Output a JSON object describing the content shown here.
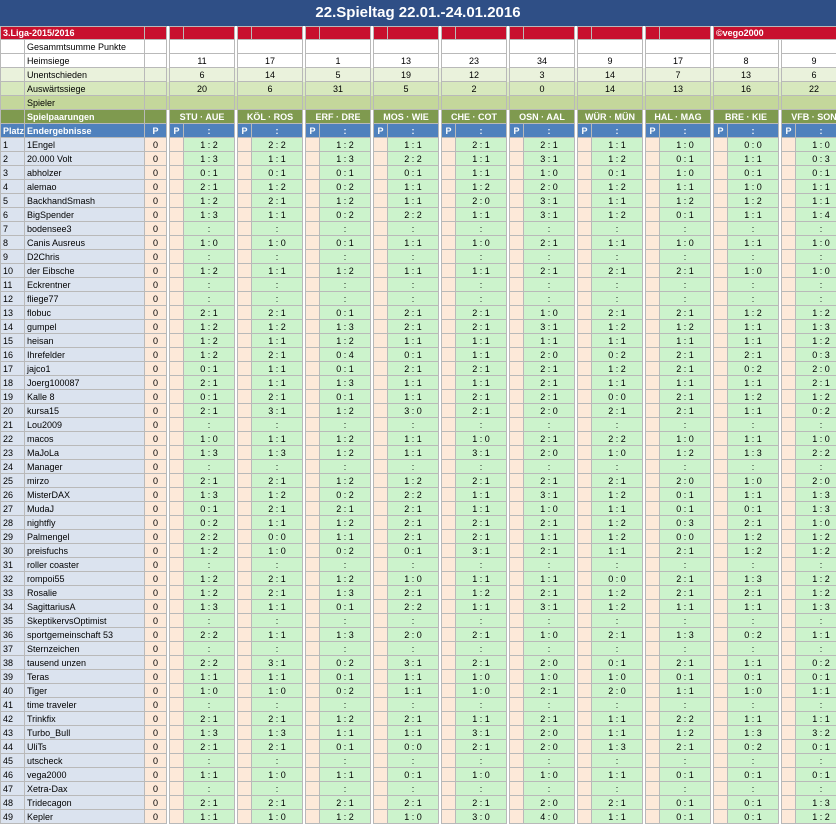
{
  "title": "22.Spieltag 22.01.-24.01.2016",
  "league": "3.Liga-2015/2016",
  "author": "©vego2000",
  "labels": {
    "gesamt": "Gesammtsumme Punkte",
    "heim": "Heimsiege",
    "unent": "Unentschieden",
    "ausw": "Auswärtssiege",
    "spieler": "Spieler",
    "paarungen": "Spielpaarungen",
    "platz": "Platz",
    "endergebnisse": "Endergebnisse",
    "p": "P"
  },
  "matches": [
    "STU · AUE",
    "KÖL · ROS",
    "ERF · DRE",
    "MOS · WIE",
    "CHE · COT",
    "OSN · AAL",
    "WÜR · MÜN",
    "HAL · MAG",
    "BRE · KIE",
    "VFB · SON"
  ],
  "stats": {
    "heimsiege": [
      "11",
      "17",
      "1",
      "13",
      "23",
      "34",
      "9",
      "17",
      "8",
      "9"
    ],
    "unentschieden": [
      "6",
      "14",
      "5",
      "19",
      "12",
      "3",
      "14",
      "7",
      "13",
      "6"
    ],
    "auswaertssiege": [
      "20",
      "6",
      "31",
      "5",
      "2",
      "0",
      "14",
      "13",
      "16",
      "22"
    ]
  },
  "end_results": [
    ":",
    ":",
    ":",
    ":",
    ":",
    ":",
    ":",
    ":",
    ":",
    ":"
  ],
  "players": [
    {
      "rank": "1",
      "name": "1Engel",
      "pts": "0",
      "tips": [
        "1 : 2",
        "2 : 2",
        "1 : 2",
        "1 : 1",
        "2 : 1",
        "2 : 1",
        "1 : 1",
        "1 : 0",
        "0 : 0",
        "1 : 0"
      ]
    },
    {
      "rank": "2",
      "name": "20.000 Volt",
      "pts": "0",
      "tips": [
        "1 : 3",
        "1 : 1",
        "1 : 3",
        "2 : 2",
        "1 : 1",
        "3 : 1",
        "1 : 2",
        "0 : 1",
        "1 : 1",
        "0 : 3"
      ]
    },
    {
      "rank": "3",
      "name": "abholzer",
      "pts": "0",
      "tips": [
        "0 : 1",
        "0 : 1",
        "0 : 1",
        "0 : 1",
        "1 : 1",
        "1 : 0",
        "0 : 1",
        "1 : 0",
        "0 : 1",
        "0 : 1"
      ]
    },
    {
      "rank": "4",
      "name": "alemao",
      "pts": "0",
      "tips": [
        "2 : 1",
        "1 : 2",
        "0 : 2",
        "1 : 1",
        "1 : 2",
        "2 : 0",
        "1 : 2",
        "1 : 1",
        "1 : 0",
        "1 : 1"
      ]
    },
    {
      "rank": "5",
      "name": "BackhandSmash",
      "pts": "0",
      "tips": [
        "1 : 2",
        "2 : 1",
        "1 : 2",
        "1 : 1",
        "2 : 0",
        "3 : 1",
        "1 : 1",
        "1 : 2",
        "1 : 2",
        "1 : 1"
      ]
    },
    {
      "rank": "6",
      "name": "BigSpender",
      "pts": "0",
      "tips": [
        "1 : 3",
        "1 : 1",
        "0 : 2",
        "2 : 2",
        "1 : 1",
        "3 : 1",
        "1 : 2",
        "0 : 1",
        "1 : 1",
        "1 : 4"
      ]
    },
    {
      "rank": "7",
      "name": "bodensee3",
      "pts": "0",
      "tips": [
        ":",
        ":",
        ":",
        ":",
        ":",
        ":",
        ":",
        ":",
        ":",
        ":"
      ]
    },
    {
      "rank": "8",
      "name": "Canis Ausreus",
      "pts": "0",
      "tips": [
        "1 : 0",
        "1 : 0",
        "0 : 1",
        "1 : 1",
        "1 : 0",
        "2 : 1",
        "1 : 1",
        "1 : 0",
        "1 : 1",
        "1 : 0"
      ]
    },
    {
      "rank": "9",
      "name": "D2Chris",
      "pts": "0",
      "tips": [
        ":",
        ":",
        ":",
        ":",
        ":",
        ":",
        ":",
        ":",
        ":",
        ":"
      ]
    },
    {
      "rank": "10",
      "name": "der Eibsche",
      "pts": "0",
      "tips": [
        "1 : 2",
        "1 : 1",
        "1 : 2",
        "1 : 1",
        "1 : 1",
        "2 : 1",
        "2 : 1",
        "2 : 1",
        "1 : 0",
        "1 : 0"
      ]
    },
    {
      "rank": "11",
      "name": "Eckrentner",
      "pts": "0",
      "tips": [
        ":",
        ":",
        ":",
        ":",
        ":",
        ":",
        ":",
        ":",
        ":",
        ":"
      ]
    },
    {
      "rank": "12",
      "name": "fliege77",
      "pts": "0",
      "tips": [
        ":",
        ":",
        ":",
        ":",
        ":",
        ":",
        ":",
        ":",
        ":",
        ":"
      ]
    },
    {
      "rank": "13",
      "name": "flobuc",
      "pts": "0",
      "tips": [
        "2 : 1",
        "2 : 1",
        "0 : 1",
        "2 : 1",
        "2 : 1",
        "1 : 0",
        "2 : 1",
        "2 : 1",
        "1 : 2",
        "1 : 2"
      ]
    },
    {
      "rank": "14",
      "name": "gumpel",
      "pts": "0",
      "tips": [
        "1 : 2",
        "1 : 2",
        "1 : 3",
        "2 : 1",
        "2 : 1",
        "3 : 1",
        "1 : 2",
        "1 : 2",
        "1 : 1",
        "1 : 3"
      ]
    },
    {
      "rank": "15",
      "name": "heisan",
      "pts": "0",
      "tips": [
        "1 : 2",
        "1 : 1",
        "1 : 2",
        "1 : 1",
        "1 : 1",
        "1 : 1",
        "1 : 1",
        "1 : 1",
        "1 : 1",
        "1 : 2"
      ]
    },
    {
      "rank": "16",
      "name": "Ihrefelder",
      "pts": "0",
      "tips": [
        "1 : 2",
        "2 : 1",
        "0 : 4",
        "0 : 1",
        "1 : 1",
        "2 : 0",
        "0 : 2",
        "2 : 1",
        "2 : 1",
        "0 : 3"
      ]
    },
    {
      "rank": "17",
      "name": "jajco1",
      "pts": "0",
      "tips": [
        "0 : 1",
        "1 : 1",
        "0 : 1",
        "2 : 1",
        "2 : 1",
        "2 : 1",
        "1 : 2",
        "2 : 1",
        "0 : 2",
        "2 : 0"
      ]
    },
    {
      "rank": "18",
      "name": "Joerg100087",
      "pts": "0",
      "tips": [
        "2 : 1",
        "1 : 1",
        "1 : 3",
        "1 : 1",
        "1 : 1",
        "2 : 1",
        "1 : 1",
        "1 : 1",
        "1 : 1",
        "2 : 1"
      ]
    },
    {
      "rank": "19",
      "name": "Kalle 8",
      "pts": "0",
      "tips": [
        "0 : 1",
        "2 : 1",
        "0 : 1",
        "1 : 1",
        "2 : 1",
        "2 : 1",
        "0 : 0",
        "2 : 1",
        "1 : 2",
        "1 : 2"
      ]
    },
    {
      "rank": "20",
      "name": "kursa15",
      "pts": "0",
      "tips": [
        "2 : 1",
        "3 : 1",
        "1 : 2",
        "3 : 0",
        "2 : 1",
        "2 : 0",
        "2 : 1",
        "2 : 1",
        "1 : 1",
        "0 : 2"
      ]
    },
    {
      "rank": "21",
      "name": "Lou2009",
      "pts": "0",
      "tips": [
        ":",
        ":",
        ":",
        ":",
        ":",
        ":",
        ":",
        ":",
        ":",
        ":"
      ]
    },
    {
      "rank": "22",
      "name": "macos",
      "pts": "0",
      "tips": [
        "1 : 0",
        "1 : 1",
        "1 : 2",
        "1 : 1",
        "1 : 0",
        "2 : 1",
        "2 : 2",
        "1 : 0",
        "1 : 1",
        "1 : 0"
      ]
    },
    {
      "rank": "23",
      "name": "MaJoLa",
      "pts": "0",
      "tips": [
        "1 : 3",
        "1 : 3",
        "1 : 2",
        "1 : 1",
        "3 : 1",
        "2 : 0",
        "1 : 0",
        "1 : 2",
        "1 : 3",
        "2 : 2"
      ]
    },
    {
      "rank": "24",
      "name": "Manager",
      "pts": "0",
      "tips": [
        ":",
        ":",
        ":",
        ":",
        ":",
        ":",
        ":",
        ":",
        ":",
        ":"
      ]
    },
    {
      "rank": "25",
      "name": "mirzo",
      "pts": "0",
      "tips": [
        "2 : 1",
        "2 : 1",
        "1 : 2",
        "1 : 2",
        "2 : 1",
        "2 : 1",
        "2 : 1",
        "2 : 0",
        "1 : 0",
        "2 : 0"
      ]
    },
    {
      "rank": "26",
      "name": "MisterDAX",
      "pts": "0",
      "tips": [
        "1 : 3",
        "1 : 2",
        "0 : 2",
        "2 : 2",
        "1 : 1",
        "3 : 1",
        "1 : 2",
        "0 : 1",
        "1 : 1",
        "1 : 3"
      ]
    },
    {
      "rank": "27",
      "name": "MudaJ",
      "pts": "0",
      "tips": [
        "0 : 1",
        "2 : 1",
        "2 : 1",
        "2 : 1",
        "1 : 1",
        "1 : 0",
        "1 : 1",
        "0 : 1",
        "0 : 1",
        "1 : 3"
      ]
    },
    {
      "rank": "28",
      "name": "nightfly",
      "pts": "0",
      "tips": [
        "0 : 2",
        "1 : 1",
        "1 : 2",
        "2 : 1",
        "2 : 1",
        "2 : 1",
        "1 : 2",
        "0 : 3",
        "2 : 1",
        "1 : 0"
      ]
    },
    {
      "rank": "29",
      "name": "Palmengel",
      "pts": "0",
      "tips": [
        "2 : 2",
        "0 : 0",
        "1 : 1",
        "2 : 1",
        "2 : 1",
        "1 : 1",
        "1 : 2",
        "0 : 0",
        "1 : 2",
        "1 : 2"
      ]
    },
    {
      "rank": "30",
      "name": "preisfuchs",
      "pts": "0",
      "tips": [
        "1 : 2",
        "1 : 0",
        "0 : 2",
        "0 : 1",
        "3 : 1",
        "2 : 1",
        "1 : 1",
        "2 : 1",
        "1 : 2",
        "1 : 2"
      ]
    },
    {
      "rank": "31",
      "name": "roller coaster",
      "pts": "0",
      "tips": [
        ":",
        ":",
        ":",
        ":",
        ":",
        ":",
        ":",
        ":",
        ":",
        ":"
      ]
    },
    {
      "rank": "32",
      "name": "rompoi55",
      "pts": "0",
      "tips": [
        "1 : 2",
        "2 : 1",
        "1 : 2",
        "1 : 0",
        "1 : 1",
        "1 : 1",
        "0 : 0",
        "2 : 1",
        "1 : 3",
        "1 : 2"
      ]
    },
    {
      "rank": "33",
      "name": "Rosalie",
      "pts": "0",
      "tips": [
        "1 : 2",
        "2 : 1",
        "1 : 3",
        "2 : 1",
        "1 : 2",
        "2 : 1",
        "1 : 2",
        "2 : 1",
        "2 : 1",
        "1 : 2"
      ]
    },
    {
      "rank": "34",
      "name": "SagittariusA",
      "pts": "0",
      "tips": [
        "1 : 3",
        "1 : 1",
        "0 : 1",
        "2 : 2",
        "1 : 1",
        "3 : 1",
        "1 : 2",
        "1 : 1",
        "1 : 1",
        "1 : 3"
      ]
    },
    {
      "rank": "35",
      "name": "SkeptikervsOptimist",
      "pts": "0",
      "tips": [
        ":",
        ":",
        ":",
        ":",
        ":",
        ":",
        ":",
        ":",
        ":",
        ":"
      ]
    },
    {
      "rank": "36",
      "name": "sportgemeinschaft 53",
      "pts": "0",
      "tips": [
        "2 : 2",
        "1 : 1",
        "1 : 3",
        "2 : 0",
        "2 : 1",
        "1 : 0",
        "2 : 1",
        "1 : 3",
        "0 : 2",
        "1 : 1"
      ]
    },
    {
      "rank": "37",
      "name": "Sternzeichen",
      "pts": "0",
      "tips": [
        ":",
        ":",
        ":",
        ":",
        ":",
        ":",
        ":",
        ":",
        ":",
        ":"
      ]
    },
    {
      "rank": "38",
      "name": "tausend unzen",
      "pts": "0",
      "tips": [
        "2 : 2",
        "3 : 1",
        "0 : 2",
        "3 : 1",
        "2 : 1",
        "2 : 0",
        "0 : 1",
        "2 : 1",
        "1 : 1",
        "0 : 2"
      ]
    },
    {
      "rank": "39",
      "name": "Teras",
      "pts": "0",
      "tips": [
        "1 : 1",
        "1 : 1",
        "0 : 1",
        "1 : 1",
        "1 : 0",
        "1 : 0",
        "1 : 0",
        "0 : 1",
        "0 : 1",
        "0 : 1"
      ]
    },
    {
      "rank": "40",
      "name": "Tiger",
      "pts": "0",
      "tips": [
        "1 : 0",
        "1 : 0",
        "0 : 2",
        "1 : 1",
        "1 : 0",
        "2 : 1",
        "2 : 0",
        "1 : 1",
        "1 : 0",
        "1 : 1"
      ]
    },
    {
      "rank": "41",
      "name": "time traveler",
      "pts": "0",
      "tips": [
        ":",
        ":",
        ":",
        ":",
        ":",
        ":",
        ":",
        ":",
        ":",
        ":"
      ]
    },
    {
      "rank": "42",
      "name": "Trinkfix",
      "pts": "0",
      "tips": [
        "2 : 1",
        "2 : 1",
        "1 : 2",
        "2 : 1",
        "1 : 1",
        "2 : 1",
        "1 : 1",
        "2 : 2",
        "1 : 1",
        "1 : 1"
      ]
    },
    {
      "rank": "43",
      "name": "Turbo_Bull",
      "pts": "0",
      "tips": [
        "1 : 3",
        "1 : 3",
        "1 : 1",
        "1 : 1",
        "3 : 1",
        "2 : 0",
        "1 : 1",
        "1 : 2",
        "1 : 3",
        "3 : 2"
      ]
    },
    {
      "rank": "44",
      "name": "UliTs",
      "pts": "0",
      "tips": [
        "2 : 1",
        "2 : 1",
        "0 : 1",
        "0 : 0",
        "2 : 1",
        "2 : 0",
        "1 : 3",
        "2 : 1",
        "0 : 2",
        "0 : 1"
      ]
    },
    {
      "rank": "45",
      "name": "utscheck",
      "pts": "0",
      "tips": [
        ":",
        ":",
        ":",
        ":",
        ":",
        ":",
        ":",
        ":",
        ":",
        ":"
      ]
    },
    {
      "rank": "46",
      "name": "vega2000",
      "pts": "0",
      "tips": [
        "1 : 1",
        "1 : 0",
        "1 : 1",
        "0 : 1",
        "1 : 0",
        "1 : 0",
        "1 : 1",
        "0 : 1",
        "0 : 1",
        "0 : 1"
      ]
    },
    {
      "rank": "47",
      "name": "Xetra-Dax",
      "pts": "0",
      "tips": [
        ":",
        ":",
        ":",
        ":",
        ":",
        ":",
        ":",
        ":",
        ":",
        ":"
      ]
    },
    {
      "rank": "48",
      "name": "Tridecagon",
      "pts": "0",
      "tips": [
        "2 : 1",
        "2 : 1",
        "2 : 1",
        "2 : 1",
        "2 : 1",
        "2 : 0",
        "2 : 1",
        "0 : 1",
        "0 : 1",
        "1 : 3"
      ]
    },
    {
      "rank": "49",
      "name": "Kepler",
      "pts": "0",
      "tips": [
        "1 : 1",
        "1 : 0",
        "1 : 2",
        "1 : 0",
        "3 : 0",
        "4 : 0",
        "1 : 1",
        "0 : 1",
        "0 : 1",
        "1 : 2"
      ]
    }
  ]
}
